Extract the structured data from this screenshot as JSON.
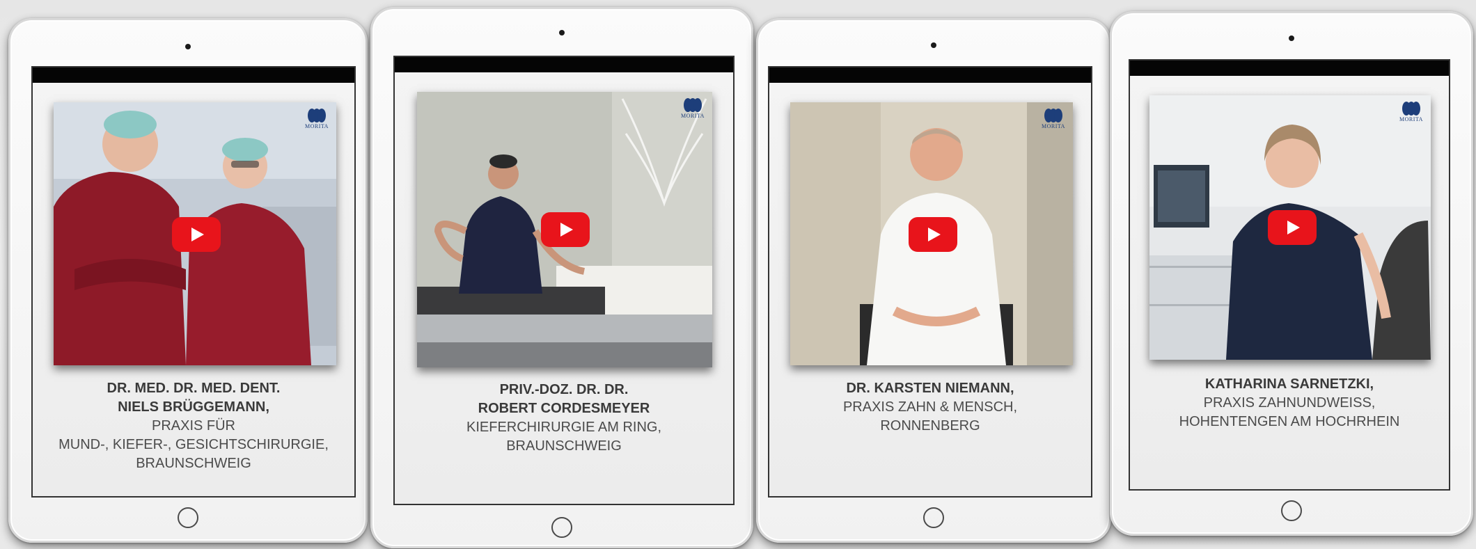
{
  "brand": {
    "logo_text": "MORITA",
    "logo_color": "#1d3e7a",
    "play_color": "#e8141b"
  },
  "cards": [
    {
      "bold_lines": [
        "DR. MED. DR. MED. DENT.",
        "NIELS BRÜGGEMANN,"
      ],
      "lines": [
        "PRAXIS FÜR",
        "MUND-, KIEFER-, GESICHTSCHIRURGIE,",
        "BRAUNSCHWEIG"
      ],
      "play_icon": "youtube-play-icon"
    },
    {
      "bold_lines": [
        "PRIV.-DOZ. DR. DR.",
        "ROBERT CORDESMEYER"
      ],
      "lines": [
        "KIEFERCHIRURGIE AM RING,",
        "BRAUNSCHWEIG"
      ],
      "play_icon": "youtube-play-icon"
    },
    {
      "bold_lines": [
        "DR. KARSTEN NIEMANN,"
      ],
      "lines": [
        "PRAXIS ZAHN & MENSCH,",
        "RONNENBERG"
      ],
      "play_icon": "youtube-play-icon"
    },
    {
      "bold_lines": [
        "KATHARINA SARNETZKI,"
      ],
      "lines": [
        "PRAXIS ZAHNUNDWEISS,",
        "HOHENTENGEN AM HOCHRHEIN"
      ],
      "play_icon": "youtube-play-icon"
    }
  ]
}
